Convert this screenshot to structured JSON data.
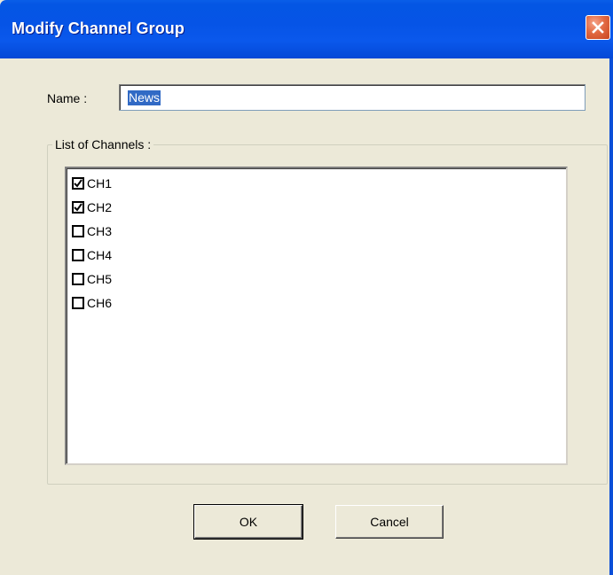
{
  "window": {
    "title": "Modify Channel Group",
    "close_icon": "close-icon"
  },
  "form": {
    "name_label": "Name :",
    "name_value": "News",
    "group_label": "List of Channels :",
    "channels": [
      {
        "label": "CH1",
        "checked": true
      },
      {
        "label": "CH2",
        "checked": true
      },
      {
        "label": "CH3",
        "checked": false
      },
      {
        "label": "CH4",
        "checked": false
      },
      {
        "label": "CH5",
        "checked": false
      },
      {
        "label": "CH6",
        "checked": false
      }
    ]
  },
  "buttons": {
    "ok_label": "OK",
    "cancel_label": "Cancel"
  },
  "colors": {
    "titlebar": "#0456e4",
    "dialog_bg": "#ece9d8",
    "selection": "#316ac5",
    "close_button": "#e26a43"
  }
}
